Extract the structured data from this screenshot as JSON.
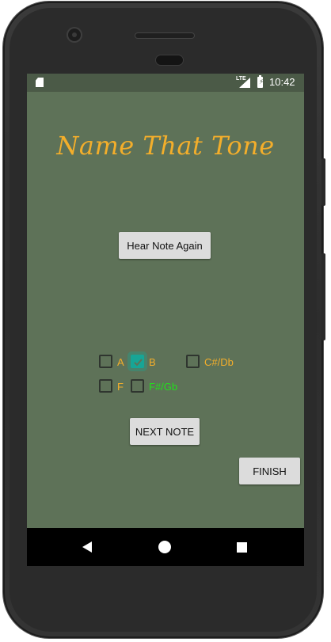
{
  "status_bar": {
    "network_label": "LTE",
    "time": "10:42",
    "icons": [
      "sd-card-icon",
      "signal-icon",
      "battery-charging-icon"
    ]
  },
  "app": {
    "title": "Name That Tone",
    "hear_again_label": "Hear Note Again",
    "next_note_label": "NEXT NOTE",
    "finish_label": "FINISH",
    "options": [
      {
        "label": "A",
        "checked": false,
        "correct": false
      },
      {
        "label": "B",
        "checked": true,
        "correct": false
      },
      {
        "label": "C#/Db",
        "checked": false,
        "correct": false
      },
      {
        "label": "F",
        "checked": false,
        "correct": false
      },
      {
        "label": "F#/Gb",
        "checked": false,
        "correct": true
      }
    ]
  },
  "nav_bar": {
    "icons": [
      "back-icon",
      "home-icon",
      "recents-icon"
    ]
  },
  "colors": {
    "screen_background": "#5e7258",
    "title_color": "#f3ae2b",
    "option_label_color": "#f3ae2b",
    "correct_option_color": "#22e01c",
    "checkbox_checked_color": "#17a596",
    "button_background": "#dcdcdc"
  }
}
